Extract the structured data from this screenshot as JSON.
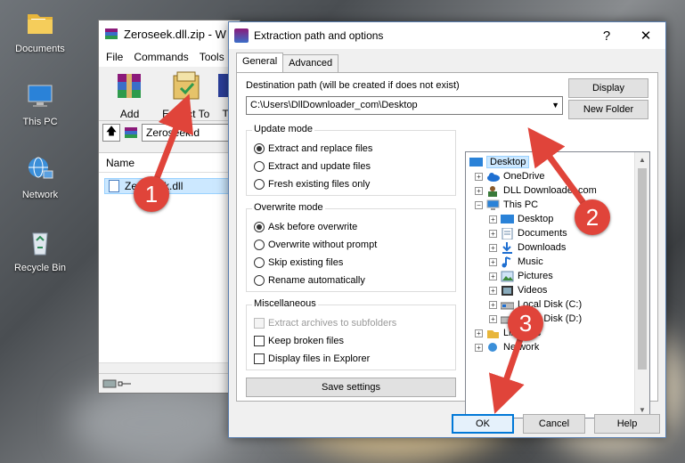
{
  "desktop": {
    "icons": [
      {
        "label": "Documents",
        "icon": "folder-icon"
      },
      {
        "label": "This PC",
        "icon": "computer-icon"
      },
      {
        "label": "Network",
        "icon": "network-icon"
      },
      {
        "label": "Recycle Bin",
        "icon": "recycle-bin-icon"
      }
    ]
  },
  "winrar": {
    "title": "Zeroseek.dll.zip - W",
    "menu": [
      "File",
      "Commands",
      "Tools"
    ],
    "toolbar": {
      "add_label": "Add",
      "extract_label": "Extract To",
      "more_label": "T"
    },
    "address": "Zeroseek.d",
    "column_name": "Name",
    "file": "Zeroseek.dll"
  },
  "dialog": {
    "title": "Extraction path and options",
    "help_symbol": "?",
    "close_symbol": "✕",
    "tabs": [
      "General",
      "Advanced"
    ],
    "destination_label": "Destination path (will be created if does not exist)",
    "destination_value": "C:\\Users\\DllDownloader_com\\Desktop",
    "display_button": "Display",
    "new_folder_button": "New Folder",
    "update_mode": {
      "title": "Update mode",
      "options": [
        "Extract and replace files",
        "Extract and update files",
        "Fresh existing files only"
      ],
      "selected": 0
    },
    "overwrite_mode": {
      "title": "Overwrite mode",
      "options": [
        "Ask before overwrite",
        "Overwrite without prompt",
        "Skip existing files",
        "Rename automatically"
      ],
      "selected": 0
    },
    "misc": {
      "title": "Miscellaneous",
      "options": [
        "Extract archives to subfolders",
        "Keep broken files",
        "Display files in Explorer"
      ]
    },
    "save_settings": "Save settings",
    "tree": [
      {
        "label": "Desktop",
        "icon": "desktop-icon",
        "selected": true
      },
      {
        "label": "OneDrive",
        "icon": "cloud-icon"
      },
      {
        "label": "DLL Downloader.com",
        "icon": "user-icon"
      },
      {
        "label": "This PC",
        "icon": "computer-icon"
      },
      {
        "label": "Desktop",
        "icon": "desktop-icon"
      },
      {
        "label": "Documents",
        "icon": "documents-icon"
      },
      {
        "label": "Downloads",
        "icon": "downloads-icon"
      },
      {
        "label": "Music",
        "icon": "music-icon"
      },
      {
        "label": "Pictures",
        "icon": "pictures-icon"
      },
      {
        "label": "Videos",
        "icon": "videos-icon"
      },
      {
        "label": "Local Disk (C:)",
        "icon": "drive-icon"
      },
      {
        "label": "Local Disk (D:)",
        "icon": "drive-icon"
      },
      {
        "label": "Libraries",
        "icon": "libraries-icon"
      },
      {
        "label": "Network",
        "icon": "network-icon"
      }
    ],
    "ok_button": "OK",
    "cancel_button": "Cancel",
    "help_button": "Help"
  },
  "annotations": {
    "step1": "1",
    "step2": "2",
    "step3": "3",
    "color": "#e0443a"
  }
}
